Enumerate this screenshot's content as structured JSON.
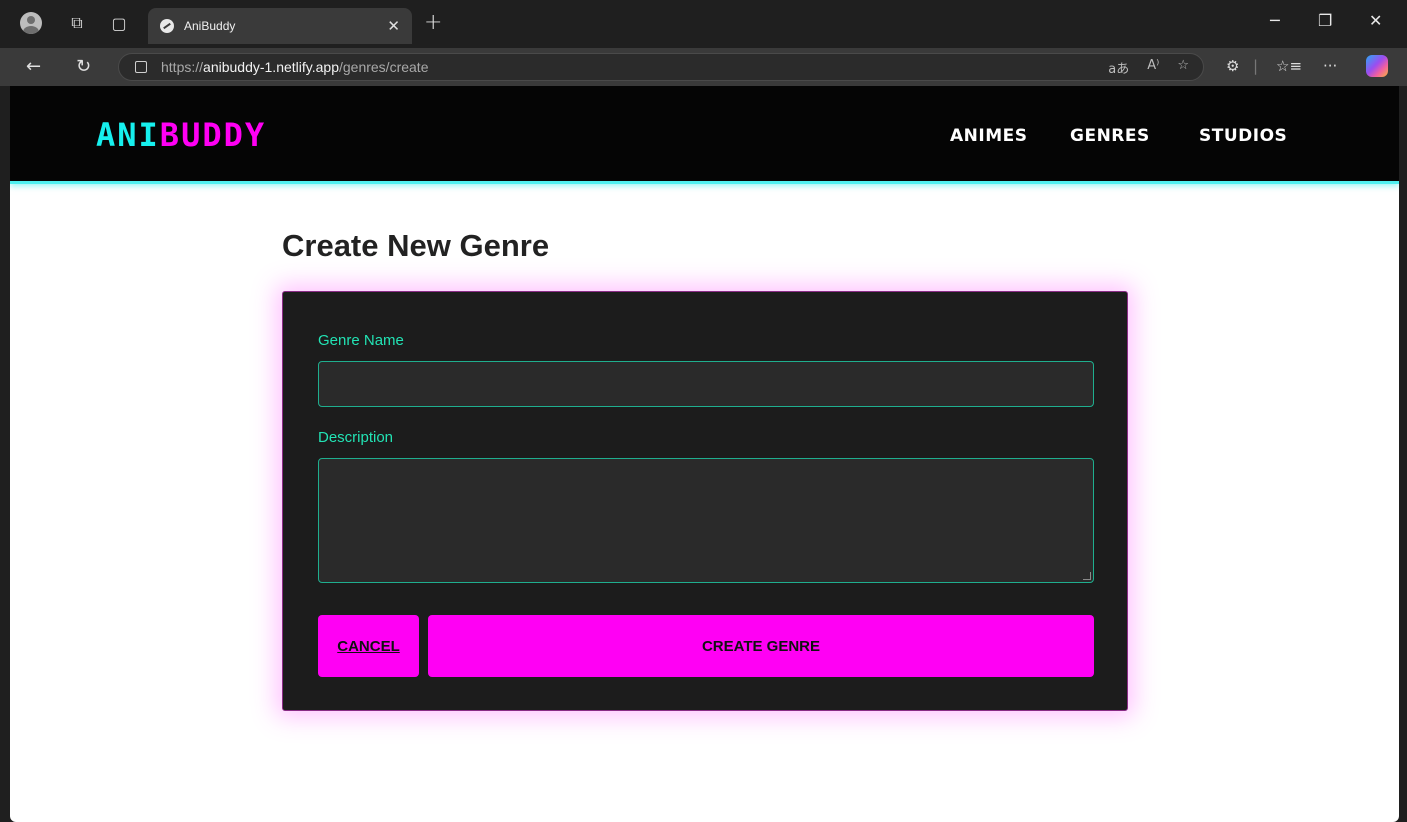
{
  "browser": {
    "tab": {
      "title": "AniBuddy"
    },
    "address": {
      "scheme": "https://",
      "host": "anibuddy-1.netlify.app",
      "path": "/genres/create"
    },
    "icons": [
      "profile-icon",
      "workspaces-icon",
      "tab-actions-icon",
      "site-favicon",
      "close-icon",
      "new-tab-icon",
      "minimize-icon",
      "restore-icon",
      "window-close-icon",
      "back-icon",
      "refresh-icon",
      "site-info-icon",
      "translate-icon",
      "read-aloud-icon",
      "favorite-star-icon",
      "extensions-icon",
      "favorites-icon",
      "more-icon",
      "copilot-icon"
    ]
  },
  "site": {
    "logo": {
      "part1": "ANI",
      "part2": "BUDDY"
    },
    "nav": [
      "ANIMES",
      "GENRES",
      "STUDIOS"
    ],
    "colors": {
      "cyan": "#16f0ee",
      "magenta": "#ff00f4",
      "teal_label": "#22e3b4"
    }
  },
  "page": {
    "title": "Create New Genre",
    "form": {
      "name_label": "Genre Name",
      "name_value": "",
      "description_label": "Description",
      "description_value": "",
      "cancel_label": "CANCEL",
      "submit_label": "CREATE GENRE"
    }
  }
}
